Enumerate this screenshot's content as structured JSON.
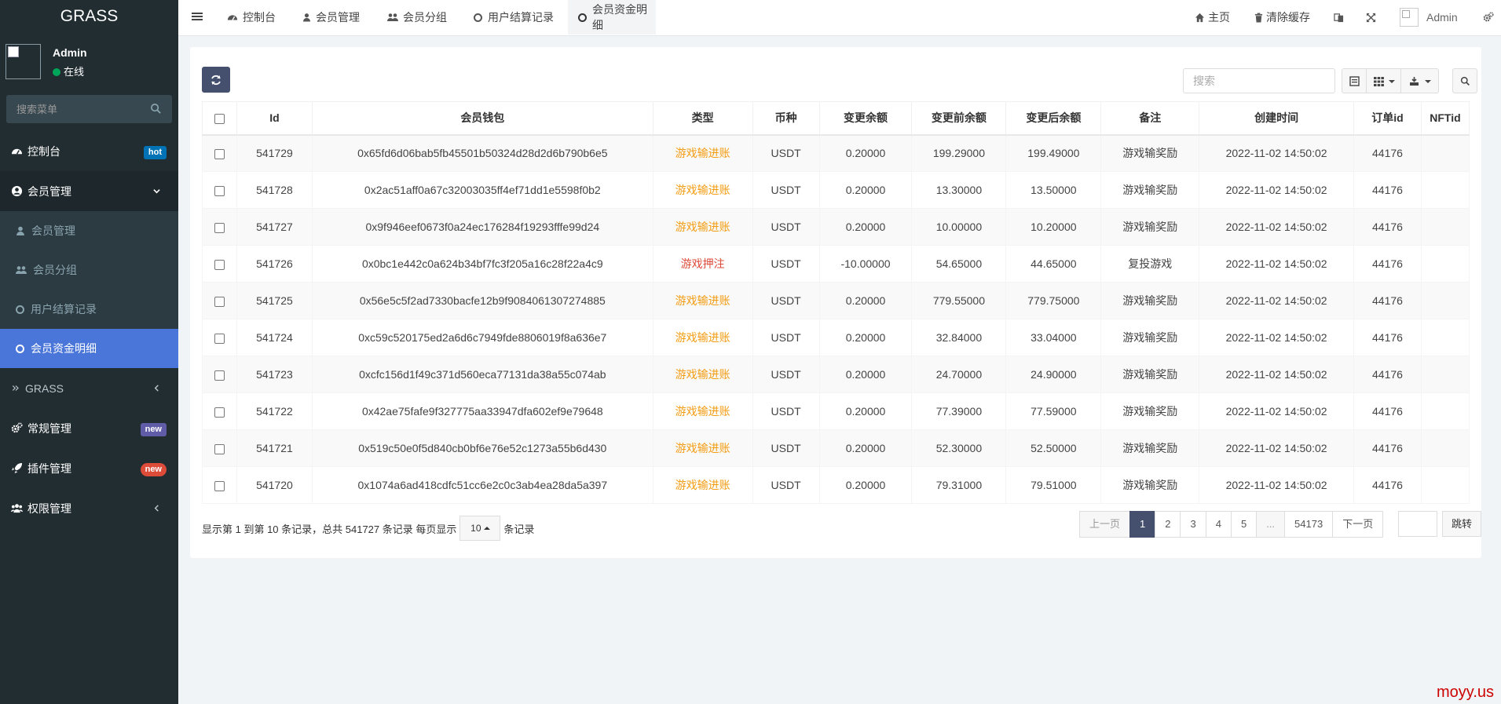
{
  "sidebar": {
    "logo": "GRASS",
    "user": {
      "name": "Admin",
      "status": "在线"
    },
    "search_placeholder": "搜索菜单",
    "menu": [
      {
        "label": "控制台",
        "icon": "dashboard-icon",
        "badge": "hot",
        "badge_color": "#0073b7"
      },
      {
        "label": "会员管理",
        "icon": "user-circle-icon",
        "expanded": true
      },
      {
        "label": "GRASS",
        "icon": "angle-double-right-icon"
      },
      {
        "label": "常规管理",
        "icon": "cogs-icon",
        "badge": "new",
        "badge_color": "#605ca8"
      },
      {
        "label": "插件管理",
        "icon": "rocket-icon",
        "badge": "new",
        "badge_color": "#dd4b39"
      },
      {
        "label": "权限管理",
        "icon": "group-icon"
      }
    ],
    "submenu": [
      {
        "label": "会员管理",
        "icon": "user-icon"
      },
      {
        "label": "会员分组",
        "icon": "users-icon"
      },
      {
        "label": "用户结算记录",
        "icon": "circle-icon"
      },
      {
        "label": "会员资金明细",
        "icon": "circle-icon",
        "active": true
      }
    ]
  },
  "topbar": {
    "tabs": [
      {
        "label": "控制台",
        "icon": "dashboard-icon"
      },
      {
        "label": "会员管理",
        "icon": "user-icon"
      },
      {
        "label": "会员分组",
        "icon": "users-icon"
      },
      {
        "label": "用户结算记录",
        "icon": "circle-icon"
      },
      {
        "label": "会员资金明细",
        "icon": "circle-icon",
        "active": true
      }
    ],
    "right": {
      "home": "主页",
      "clear_cache": "清除缓存",
      "admin": "Admin"
    }
  },
  "toolbar": {
    "search_placeholder": "搜索"
  },
  "table": {
    "columns": [
      "Id",
      "会员钱包",
      "类型",
      "币种",
      "变更余额",
      "变更前余额",
      "变更后余额",
      "备注",
      "创建时间",
      "订单id",
      "NFTid"
    ],
    "rows": [
      {
        "id": "541729",
        "wallet": "0x65fd6d06bab5fb45501b50324d28d2d6b790b6e5",
        "type": "游戏输进账",
        "type_color": "orange",
        "coin": "USDT",
        "change": "0.20000",
        "before": "199.29000",
        "after": "199.49000",
        "note": "游戏输奖励",
        "time": "2022-11-02 14:50:02",
        "order": "44176",
        "nft": ""
      },
      {
        "id": "541728",
        "wallet": "0x2ac51aff0a67c32003035ff4ef71dd1e5598f0b2",
        "type": "游戏输进账",
        "type_color": "orange",
        "coin": "USDT",
        "change": "0.20000",
        "before": "13.30000",
        "after": "13.50000",
        "note": "游戏输奖励",
        "time": "2022-11-02 14:50:02",
        "order": "44176",
        "nft": ""
      },
      {
        "id": "541727",
        "wallet": "0x9f946eef0673f0a24ec176284f19293fffe99d24",
        "type": "游戏输进账",
        "type_color": "orange",
        "coin": "USDT",
        "change": "0.20000",
        "before": "10.00000",
        "after": "10.20000",
        "note": "游戏输奖励",
        "time": "2022-11-02 14:50:02",
        "order": "44176",
        "nft": ""
      },
      {
        "id": "541726",
        "wallet": "0x0bc1e442c0a624b34bf7fc3f205a16c28f22a4c9",
        "type": "游戏押注",
        "type_color": "red",
        "coin": "USDT",
        "change": "-10.00000",
        "before": "54.65000",
        "after": "44.65000",
        "note": "复投游戏",
        "time": "2022-11-02 14:50:02",
        "order": "44176",
        "nft": ""
      },
      {
        "id": "541725",
        "wallet": "0x56e5c5f2ad7330bacfe12b9f9084061307274885",
        "type": "游戏输进账",
        "type_color": "orange",
        "coin": "USDT",
        "change": "0.20000",
        "before": "779.55000",
        "after": "779.75000",
        "note": "游戏输奖励",
        "time": "2022-11-02 14:50:02",
        "order": "44176",
        "nft": ""
      },
      {
        "id": "541724",
        "wallet": "0xc59c520175ed2a6d6c7949fde8806019f8a636e7",
        "type": "游戏输进账",
        "type_color": "orange",
        "coin": "USDT",
        "change": "0.20000",
        "before": "32.84000",
        "after": "33.04000",
        "note": "游戏输奖励",
        "time": "2022-11-02 14:50:02",
        "order": "44176",
        "nft": ""
      },
      {
        "id": "541723",
        "wallet": "0xcfc156d1f49c371d560eca77131da38a55c074ab",
        "type": "游戏输进账",
        "type_color": "orange",
        "coin": "USDT",
        "change": "0.20000",
        "before": "24.70000",
        "after": "24.90000",
        "note": "游戏输奖励",
        "time": "2022-11-02 14:50:02",
        "order": "44176",
        "nft": ""
      },
      {
        "id": "541722",
        "wallet": "0x42ae75fafe9f327775aa33947dfa602ef9e79648",
        "type": "游戏输进账",
        "type_color": "orange",
        "coin": "USDT",
        "change": "0.20000",
        "before": "77.39000",
        "after": "77.59000",
        "note": "游戏输奖励",
        "time": "2022-11-02 14:50:02",
        "order": "44176",
        "nft": ""
      },
      {
        "id": "541721",
        "wallet": "0x519c50e0f5d840cb0bf6e76e52c1273a55b6d430",
        "type": "游戏输进账",
        "type_color": "orange",
        "coin": "USDT",
        "change": "0.20000",
        "before": "52.30000",
        "after": "52.50000",
        "note": "游戏输奖励",
        "time": "2022-11-02 14:50:02",
        "order": "44176",
        "nft": ""
      },
      {
        "id": "541720",
        "wallet": "0x1074a6ad418cdfc51cc6e2c0c3ab4ea28da5a397",
        "type": "游戏输进账",
        "type_color": "orange",
        "coin": "USDT",
        "change": "0.20000",
        "before": "79.31000",
        "after": "79.51000",
        "note": "游戏输奖励",
        "time": "2022-11-02 14:50:02",
        "order": "44176",
        "nft": ""
      }
    ]
  },
  "footer": {
    "info_prefix": "显示第 1 到第 10 条记录，总共 541727 条记录 每页显示",
    "page_size": "10",
    "info_suffix": "条记录",
    "prev": "上一页",
    "pages": [
      "1",
      "2",
      "3",
      "4",
      "5",
      "...",
      "54173"
    ],
    "current_page": "1",
    "next": "下一页",
    "jump": "跳转"
  },
  "watermark": "moyy.us",
  "colors": {
    "sidebar_bg": "#222d32",
    "active_menu": "#4a76d9",
    "primary_button": "#454f6e",
    "type_orange": "#f39c12",
    "type_red": "#dd4b39"
  }
}
